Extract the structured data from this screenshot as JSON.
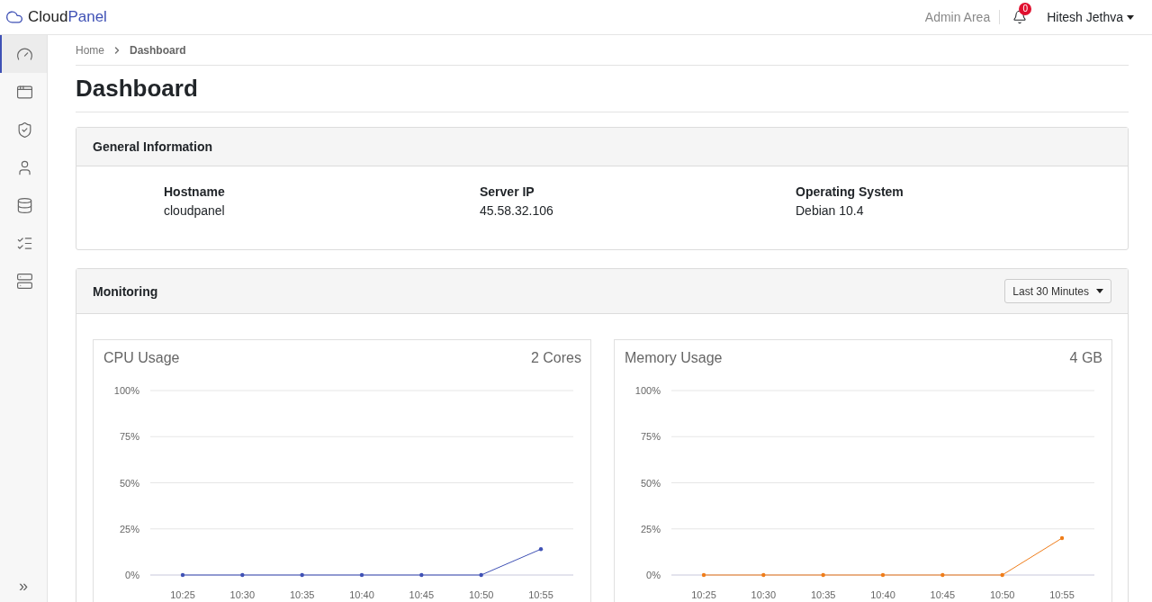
{
  "brand": {
    "part_1": "Cloud",
    "part_2": "Panel"
  },
  "header": {
    "admin_link": "Admin Area",
    "notifications_count": "0",
    "user": "Hitesh Jethva"
  },
  "sidebar": {
    "items": [
      {
        "selected": true
      },
      {
        "selected": false
      },
      {
        "selected": false
      },
      {
        "selected": false
      },
      {
        "selected": false
      },
      {
        "selected": false
      },
      {
        "selected": false
      }
    ],
    "collapse": "»"
  },
  "breadcrumb": [
    "Home",
    "Dashboard"
  ],
  "title": "Dashboard",
  "general_information": {
    "title": "General Information",
    "fields": [
      {
        "label": "Hostname",
        "value": "cloudpanel"
      },
      {
        "label": "Server IP",
        "value": "45.58.32.106"
      },
      {
        "label": "Operating System",
        "value": "Debian 10.4"
      }
    ]
  },
  "monitoring": {
    "title": "Monitoring",
    "range": "Last 30 Minutes",
    "charts": [
      {
        "title": "CPU Usage",
        "info": "2 Cores",
        "chart_data": {
          "type": "line",
          "grid": true,
          "categories": [
            "10:25",
            "10:30",
            "10:35",
            "10:40",
            "10:45",
            "10:50",
            "10:55"
          ],
          "series": [
            {
              "color": "#3f51b5",
              "values": [
                0,
                0,
                0,
                0,
                0,
                0,
                14
              ]
            }
          ],
          "ylim": [
            0,
            100
          ],
          "yticks": [
            {
              "value": 0,
              "label": "0%"
            },
            {
              "value": 25,
              "label": "25%"
            },
            {
              "value": 50,
              "label": "50%"
            },
            {
              "value": 75,
              "label": "75%"
            },
            {
              "value": 100,
              "label": "100%"
            }
          ]
        }
      },
      {
        "title": "Memory Usage",
        "info": "4 GB",
        "chart_data": {
          "type": "line",
          "grid": true,
          "categories": [
            "10:25",
            "10:30",
            "10:35",
            "10:40",
            "10:45",
            "10:50",
            "10:55"
          ],
          "series": [
            {
              "color": "#ef7d1a",
              "values": [
                0,
                0,
                0,
                0,
                0,
                0,
                20
              ]
            }
          ],
          "ylim": [
            0,
            100
          ],
          "yticks": [
            {
              "value": 0,
              "label": "0%"
            },
            {
              "value": 25,
              "label": "25%"
            },
            {
              "value": 50,
              "label": "50%"
            },
            {
              "value": 75,
              "label": "75%"
            },
            {
              "value": 100,
              "label": "100%"
            }
          ]
        }
      }
    ]
  }
}
